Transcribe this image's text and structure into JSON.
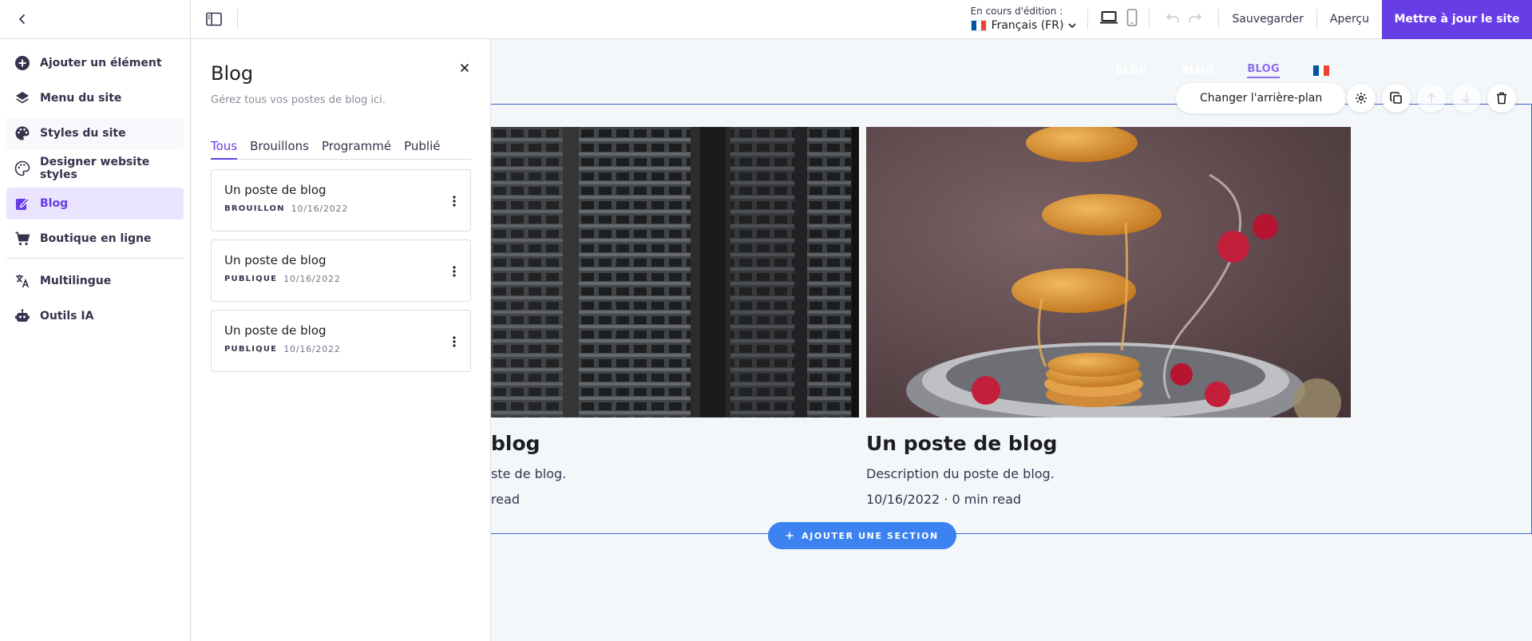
{
  "topbar": {
    "editing_caption": "En cours d'édition :",
    "language": "Français (FR)",
    "save": "Sauvegarder",
    "preview": "Aperçu",
    "publish": "Mettre à jour le site"
  },
  "sidebar": {
    "items": [
      {
        "label": "Ajouter un élément",
        "icon": "plus-circle-icon"
      },
      {
        "label": "Menu du site",
        "icon": "layers-icon"
      },
      {
        "label": "Styles du site",
        "icon": "palette-icon"
      },
      {
        "label": "Designer website styles",
        "icon": "palette-outline-icon"
      },
      {
        "label": "Blog",
        "icon": "edit-icon"
      },
      {
        "label": "Boutique en ligne",
        "icon": "cart-icon"
      },
      {
        "label": "Multilingue",
        "icon": "translate-icon"
      },
      {
        "label": "Outils IA",
        "icon": "robot-icon"
      }
    ],
    "accent": "#673de6"
  },
  "panel": {
    "title": "Blog",
    "subtitle": "Gérez tous vos postes de blog ici.",
    "tabs": [
      "Tous",
      "Brouillons",
      "Programmé",
      "Publié"
    ],
    "posts": [
      {
        "title": "Un poste de blog",
        "status": "BROUILLON",
        "date": "10/16/2022"
      },
      {
        "title": "Un poste de blog",
        "status": "PUBLIQUE",
        "date": "10/16/2022"
      },
      {
        "title": "Un poste de blog",
        "status": "PUBLIQUE",
        "date": "10/16/2022"
      }
    ]
  },
  "canvas": {
    "nav": [
      "BLOG",
      "BLOG",
      "BLOG"
    ],
    "change_background": "Changer l'arrière-plan",
    "cards": [
      {
        "title": "blog",
        "description": "ste de blog.",
        "meta": "read"
      },
      {
        "title": "Un poste de blog",
        "description": "Description du poste de blog.",
        "meta": "10/16/2022 · 0 min read"
      }
    ],
    "add_section": "AJOUTER UNE SECTION"
  }
}
